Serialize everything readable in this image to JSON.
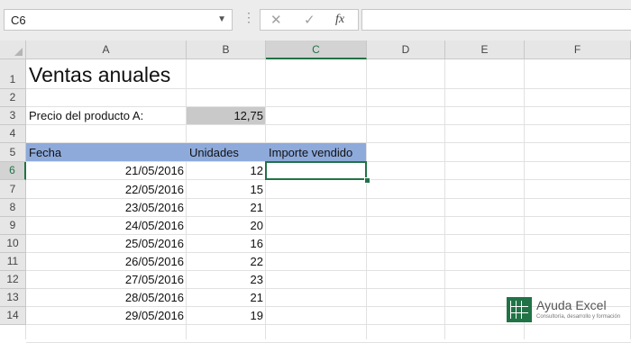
{
  "formula_bar": {
    "name_box": "C6",
    "name_box_arrow_icon": "chevron-down-icon",
    "more_icon": "vertical-dots-icon",
    "cancel_icon": "✕",
    "enter_icon": "✓",
    "function_icon": "fx",
    "formula_text": ""
  },
  "columns": [
    "A",
    "B",
    "C",
    "D",
    "E",
    "F"
  ],
  "rows": [
    "1",
    "2",
    "3",
    "4",
    "5",
    "6",
    "7",
    "8",
    "9",
    "10",
    "11",
    "12",
    "13",
    "14"
  ],
  "sheet": {
    "title": "Ventas anuales",
    "price_label": "Precio del producto A:",
    "price_value": "12,75",
    "headers": {
      "date": "Fecha",
      "units": "Unidades",
      "amount": "Importe vendido"
    },
    "records": [
      {
        "date": "21/05/2016",
        "units": "12"
      },
      {
        "date": "22/05/2016",
        "units": "15"
      },
      {
        "date": "23/05/2016",
        "units": "21"
      },
      {
        "date": "24/05/2016",
        "units": "20"
      },
      {
        "date": "25/05/2016",
        "units": "16"
      },
      {
        "date": "26/05/2016",
        "units": "22"
      },
      {
        "date": "27/05/2016",
        "units": "23"
      },
      {
        "date": "28/05/2016",
        "units": "21"
      },
      {
        "date": "29/05/2016",
        "units": "19"
      }
    ]
  },
  "selection": {
    "active_cell": "C6",
    "active_column": "C",
    "active_row": "6"
  },
  "colors": {
    "accent": "#217346",
    "header_band": "#8eaadb",
    "price_fill": "#c9c9c9"
  },
  "watermark": {
    "name": "Ayuda Excel",
    "tagline": "Consultoría, desarrollo y formación"
  }
}
